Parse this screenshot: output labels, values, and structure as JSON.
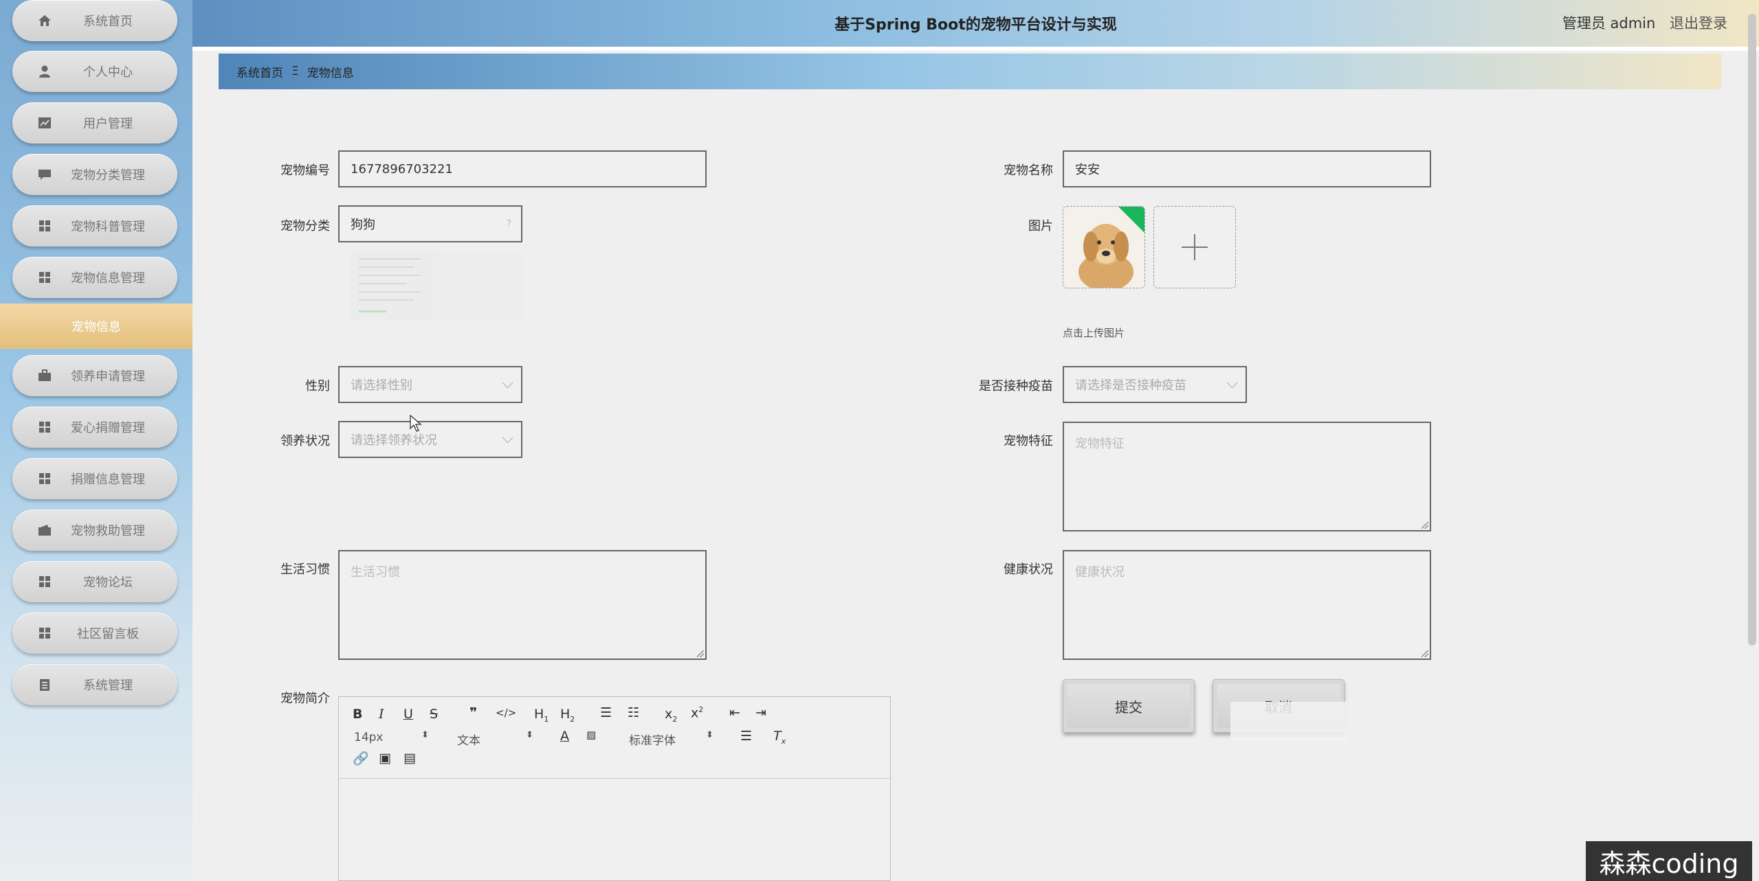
{
  "header": {
    "title": "基于Spring Boot的宠物平台设计与实现",
    "user_label": "管理员 admin",
    "logout_label": "退出登录"
  },
  "sidebar": {
    "items": [
      {
        "label": "系统首页",
        "icon": "home-icon"
      },
      {
        "label": "个人中心",
        "icon": "user-icon"
      },
      {
        "label": "用户管理",
        "icon": "chart-icon"
      },
      {
        "label": "宠物分类管理",
        "icon": "chat-icon"
      },
      {
        "label": "宠物科普管理",
        "icon": "grid-icon"
      },
      {
        "label": "宠物信息管理",
        "icon": "grid-icon"
      },
      {
        "label": "领养申请管理",
        "icon": "briefcase-icon"
      },
      {
        "label": "爱心捐赠管理",
        "icon": "grid-icon"
      },
      {
        "label": "捐赠信息管理",
        "icon": "grid-icon"
      },
      {
        "label": "宠物救助管理",
        "icon": "wallet-icon"
      },
      {
        "label": "宠物论坛",
        "icon": "grid-icon"
      },
      {
        "label": "社区留言板",
        "icon": "grid-icon"
      },
      {
        "label": "系统管理",
        "icon": "clipboard-icon"
      }
    ],
    "active_sub": "宠物信息"
  },
  "breadcrumb": {
    "home": "系统首页",
    "separator": "Ξ",
    "current": "宠物信息"
  },
  "form": {
    "pet_no": {
      "label": "宠物编号",
      "value": "1677896703221"
    },
    "pet_name": {
      "label": "宠物名称",
      "value": "安安"
    },
    "category": {
      "label": "宠物分类",
      "value": "狗狗"
    },
    "image": {
      "label": "图片",
      "hint": "点击上传图片"
    },
    "gender": {
      "label": "性别",
      "placeholder": "请选择性别"
    },
    "vaccinated": {
      "label": "是否接种疫苗",
      "placeholder": "请选择是否接种疫苗"
    },
    "adoption": {
      "label": "领养状况",
      "placeholder": "请选择领养状况"
    },
    "feature": {
      "label": "宠物特征",
      "placeholder": "宠物特征"
    },
    "habit": {
      "label": "生活习惯",
      "placeholder": "生活习惯"
    },
    "health": {
      "label": "健康状况",
      "placeholder": "健康状况"
    },
    "intro": {
      "label": "宠物简介"
    },
    "submit_label": "提交",
    "cancel_label": "取消"
  },
  "editor": {
    "font_size": "14px",
    "paragraph": "文本",
    "font_family": "标准字体"
  },
  "watermark": "森森coding",
  "colors": {
    "accent": "#e3bf7c",
    "header_start": "#5f8fc1"
  }
}
